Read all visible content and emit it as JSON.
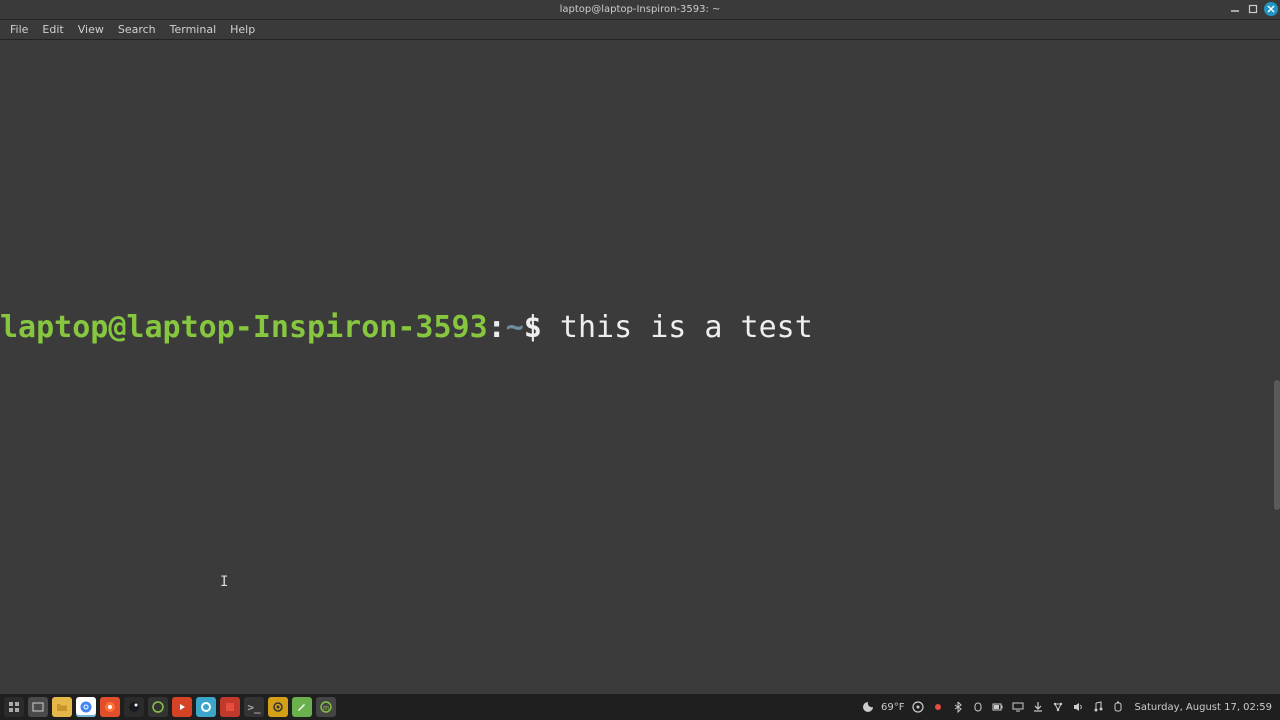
{
  "titlebar": {
    "title": "laptop@laptop-Inspiron-3593: ~"
  },
  "menubar": {
    "file": "File",
    "edit": "Edit",
    "view": "View",
    "search": "Search",
    "terminal": "Terminal",
    "help": "Help"
  },
  "prompt": {
    "user_host": "laptop@laptop-Inspiron-3593",
    "colon": ":",
    "path": "~",
    "symbol": "$",
    "input": " this is a test"
  },
  "taskbar": {
    "temperature": "69°F",
    "datetime": "Saturday, August 17, 02:59"
  }
}
